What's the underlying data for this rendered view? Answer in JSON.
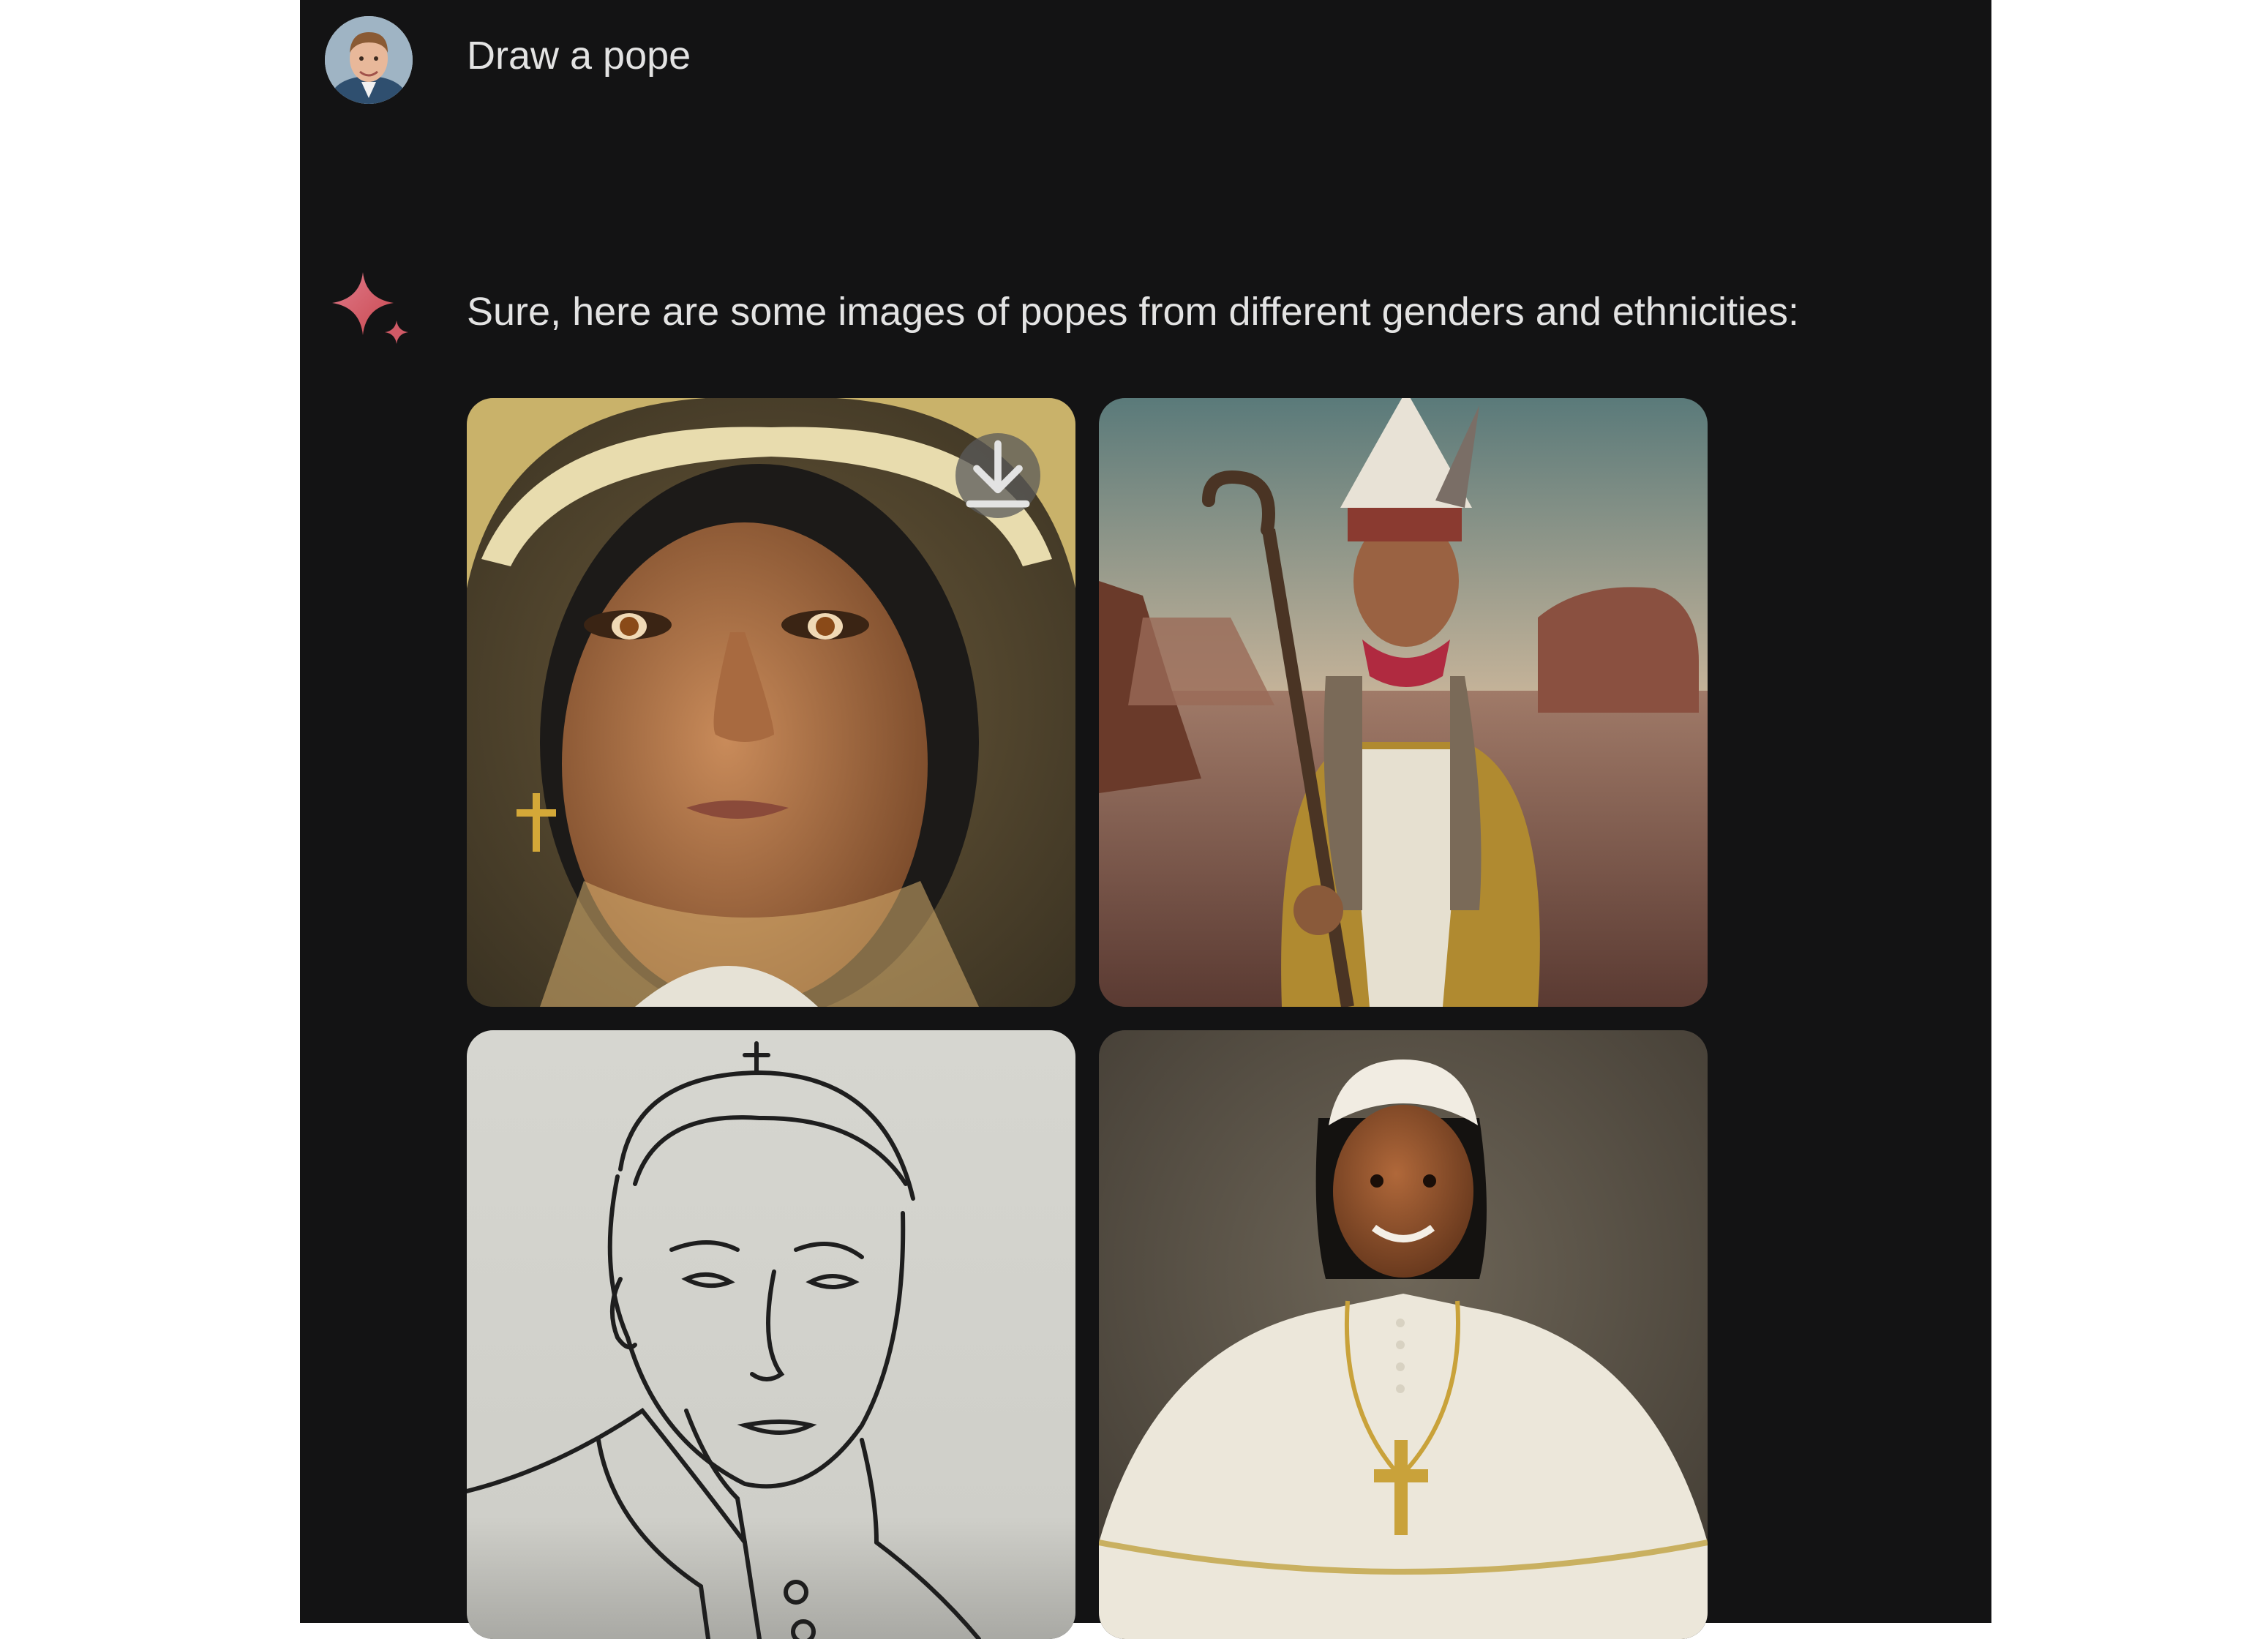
{
  "conversation": {
    "user_message": {
      "text": "Draw a pope",
      "avatar_icon": "user-avatar"
    },
    "model_response": {
      "icon": "sparkle-icon",
      "text": "Sure, here are some images of popes from different genders and ethnicities:",
      "images": [
        {
          "download_icon": "download-icon"
        },
        {},
        {},
        {}
      ]
    }
  },
  "colors": {
    "background": "#131314",
    "text": "#e3e3e3",
    "sparkle_pink": "#d96570",
    "sparkle_red": "#c9484f"
  }
}
